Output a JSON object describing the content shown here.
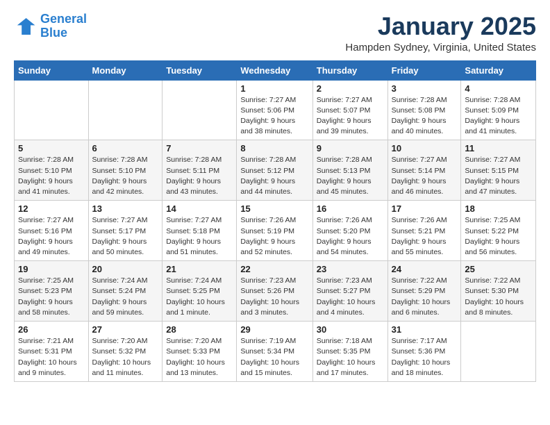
{
  "logo": {
    "line1": "General",
    "line2": "Blue"
  },
  "title": "January 2025",
  "subtitle": "Hampden Sydney, Virginia, United States",
  "days_of_week": [
    "Sunday",
    "Monday",
    "Tuesday",
    "Wednesday",
    "Thursday",
    "Friday",
    "Saturday"
  ],
  "weeks": [
    [
      {
        "day": "",
        "info": ""
      },
      {
        "day": "",
        "info": ""
      },
      {
        "day": "",
        "info": ""
      },
      {
        "day": "1",
        "info": "Sunrise: 7:27 AM\nSunset: 5:06 PM\nDaylight: 9 hours\nand 38 minutes."
      },
      {
        "day": "2",
        "info": "Sunrise: 7:27 AM\nSunset: 5:07 PM\nDaylight: 9 hours\nand 39 minutes."
      },
      {
        "day": "3",
        "info": "Sunrise: 7:28 AM\nSunset: 5:08 PM\nDaylight: 9 hours\nand 40 minutes."
      },
      {
        "day": "4",
        "info": "Sunrise: 7:28 AM\nSunset: 5:09 PM\nDaylight: 9 hours\nand 41 minutes."
      }
    ],
    [
      {
        "day": "5",
        "info": "Sunrise: 7:28 AM\nSunset: 5:10 PM\nDaylight: 9 hours\nand 41 minutes."
      },
      {
        "day": "6",
        "info": "Sunrise: 7:28 AM\nSunset: 5:10 PM\nDaylight: 9 hours\nand 42 minutes."
      },
      {
        "day": "7",
        "info": "Sunrise: 7:28 AM\nSunset: 5:11 PM\nDaylight: 9 hours\nand 43 minutes."
      },
      {
        "day": "8",
        "info": "Sunrise: 7:28 AM\nSunset: 5:12 PM\nDaylight: 9 hours\nand 44 minutes."
      },
      {
        "day": "9",
        "info": "Sunrise: 7:28 AM\nSunset: 5:13 PM\nDaylight: 9 hours\nand 45 minutes."
      },
      {
        "day": "10",
        "info": "Sunrise: 7:27 AM\nSunset: 5:14 PM\nDaylight: 9 hours\nand 46 minutes."
      },
      {
        "day": "11",
        "info": "Sunrise: 7:27 AM\nSunset: 5:15 PM\nDaylight: 9 hours\nand 47 minutes."
      }
    ],
    [
      {
        "day": "12",
        "info": "Sunrise: 7:27 AM\nSunset: 5:16 PM\nDaylight: 9 hours\nand 49 minutes."
      },
      {
        "day": "13",
        "info": "Sunrise: 7:27 AM\nSunset: 5:17 PM\nDaylight: 9 hours\nand 50 minutes."
      },
      {
        "day": "14",
        "info": "Sunrise: 7:27 AM\nSunset: 5:18 PM\nDaylight: 9 hours\nand 51 minutes."
      },
      {
        "day": "15",
        "info": "Sunrise: 7:26 AM\nSunset: 5:19 PM\nDaylight: 9 hours\nand 52 minutes."
      },
      {
        "day": "16",
        "info": "Sunrise: 7:26 AM\nSunset: 5:20 PM\nDaylight: 9 hours\nand 54 minutes."
      },
      {
        "day": "17",
        "info": "Sunrise: 7:26 AM\nSunset: 5:21 PM\nDaylight: 9 hours\nand 55 minutes."
      },
      {
        "day": "18",
        "info": "Sunrise: 7:25 AM\nSunset: 5:22 PM\nDaylight: 9 hours\nand 56 minutes."
      }
    ],
    [
      {
        "day": "19",
        "info": "Sunrise: 7:25 AM\nSunset: 5:23 PM\nDaylight: 9 hours\nand 58 minutes."
      },
      {
        "day": "20",
        "info": "Sunrise: 7:24 AM\nSunset: 5:24 PM\nDaylight: 9 hours\nand 59 minutes."
      },
      {
        "day": "21",
        "info": "Sunrise: 7:24 AM\nSunset: 5:25 PM\nDaylight: 10 hours\nand 1 minute."
      },
      {
        "day": "22",
        "info": "Sunrise: 7:23 AM\nSunset: 5:26 PM\nDaylight: 10 hours\nand 3 minutes."
      },
      {
        "day": "23",
        "info": "Sunrise: 7:23 AM\nSunset: 5:27 PM\nDaylight: 10 hours\nand 4 minutes."
      },
      {
        "day": "24",
        "info": "Sunrise: 7:22 AM\nSunset: 5:29 PM\nDaylight: 10 hours\nand 6 minutes."
      },
      {
        "day": "25",
        "info": "Sunrise: 7:22 AM\nSunset: 5:30 PM\nDaylight: 10 hours\nand 8 minutes."
      }
    ],
    [
      {
        "day": "26",
        "info": "Sunrise: 7:21 AM\nSunset: 5:31 PM\nDaylight: 10 hours\nand 9 minutes."
      },
      {
        "day": "27",
        "info": "Sunrise: 7:20 AM\nSunset: 5:32 PM\nDaylight: 10 hours\nand 11 minutes."
      },
      {
        "day": "28",
        "info": "Sunrise: 7:20 AM\nSunset: 5:33 PM\nDaylight: 10 hours\nand 13 minutes."
      },
      {
        "day": "29",
        "info": "Sunrise: 7:19 AM\nSunset: 5:34 PM\nDaylight: 10 hours\nand 15 minutes."
      },
      {
        "day": "30",
        "info": "Sunrise: 7:18 AM\nSunset: 5:35 PM\nDaylight: 10 hours\nand 17 minutes."
      },
      {
        "day": "31",
        "info": "Sunrise: 7:17 AM\nSunset: 5:36 PM\nDaylight: 10 hours\nand 18 minutes."
      },
      {
        "day": "",
        "info": ""
      }
    ]
  ]
}
